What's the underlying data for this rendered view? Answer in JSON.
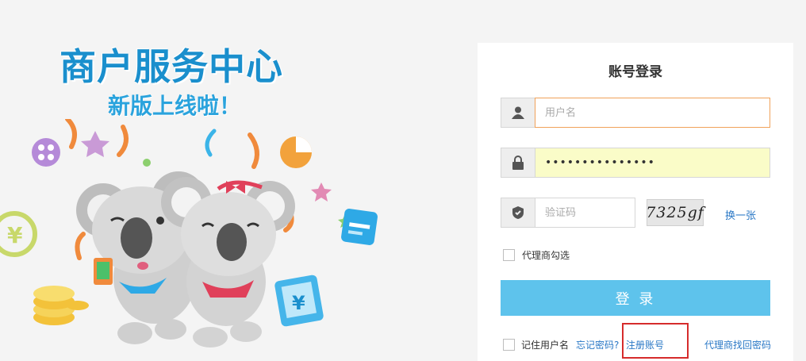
{
  "promo": {
    "title": "商户服务中心",
    "subtitle": "新版上线啦！"
  },
  "login": {
    "title": "账号登录",
    "username": {
      "placeholder": "用户名",
      "value": ""
    },
    "password": {
      "value": "•••••••••••••••"
    },
    "captcha": {
      "placeholder": "验证码",
      "image_text": "7325gf",
      "refresh_label": "换一张"
    },
    "agent_checkbox_label": "代理商勾选",
    "submit_label": "登 录",
    "remember_label": "记住用户名",
    "forgot_link": "忘记密码?",
    "register_link": "注册账号",
    "agent_recover_link": "代理商找回密码"
  },
  "colors": {
    "brand_blue": "#1a8fcd",
    "button_blue": "#5ec3ec",
    "link_blue": "#2a78c6",
    "highlight_red": "#d62c2c",
    "autofill_yellow": "#fafcc8"
  }
}
